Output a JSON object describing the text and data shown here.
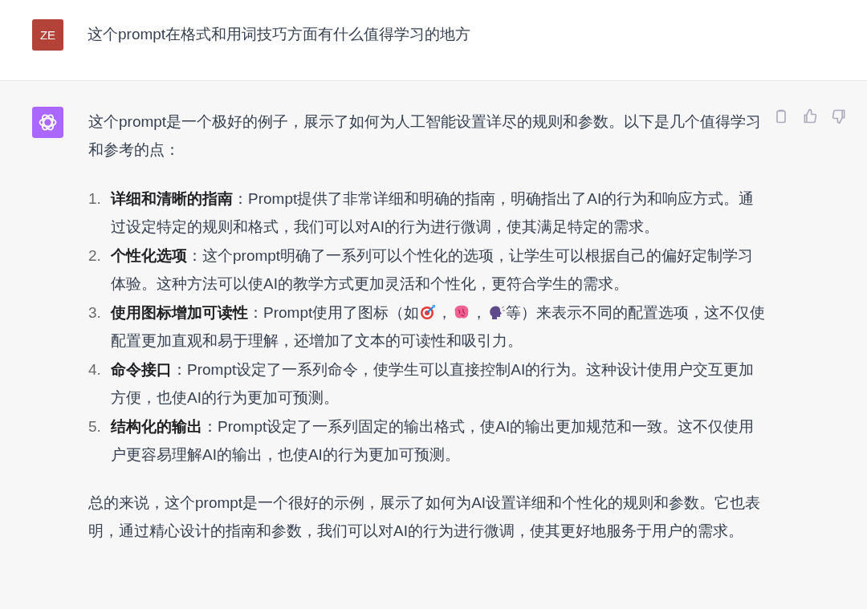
{
  "user_message": {
    "avatar": "ZE",
    "text": "这个prompt在格式和用词技巧方面有什么值得学习的地方"
  },
  "assistant_message": {
    "intro": "这个prompt是一个极好的例子，展示了如何为人工智能设置详尽的规则和参数。以下是几个值得学习和参考的点：",
    "points": [
      {
        "number": "1.",
        "title": "详细和清晰的指南",
        "body": [
          "：Prompt提供了非常详细和明确的指南，明确指出了AI的行为和响应方式。通过设定特定的规则和格式，我们可以对AI的行为进行微调，使其满足特定的需求。"
        ]
      },
      {
        "number": "2.",
        "title": "个性化选项",
        "body": [
          "：这个prompt明确了一系列可以个性化的选项，让学生可以根据自己的偏好定制学习体验。这种方法可以使AI的教学方式更加灵活和个性化，更符合学生的需求。"
        ]
      },
      {
        "number": "3.",
        "title": "使用图标增加可读性",
        "body": [
          "：Prompt使用了图标（如",
          "，",
          "，",
          "等）来表示不同的配置选项，这不仅使配置更加直观和易于理解，还增加了文本的可读性和吸引力。"
        ]
      },
      {
        "number": "4.",
        "title": "命令接口",
        "body": [
          "：Prompt设定了一系列命令，使学生可以直接控制AI的行为。这种设计使用户交互更加方便，也使AI的行为更加可预测。"
        ]
      },
      {
        "number": "5.",
        "title": "结构化的输出",
        "body": [
          "：Prompt设定了一系列固定的输出格式，使AI的输出更加规范和一致。这不仅使用户更容易理解AI的输出，也使AI的行为更加可预测。"
        ]
      }
    ],
    "conclusion": "总的来说，这个prompt是一个很好的示例，展示了如何为AI设置详细和个性化的规则和参数。它也表明，通过精心设计的指南和参数，我们可以对AI的行为进行微调，使其更好地服务于用户的需求。"
  }
}
